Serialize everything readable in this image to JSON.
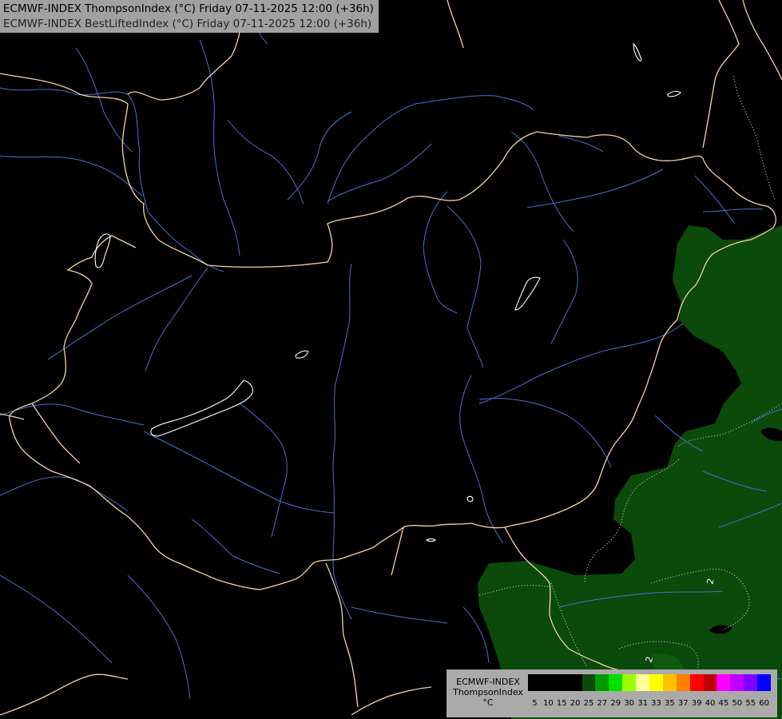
{
  "header": {
    "line1": "ECMWF-INDEX ThompsonIndex (°C) Friday 07-11-2025 12:00 (+36h)",
    "line2": "ECMWF-INDEX BestLiftedIndex (°C) Friday 07-11-2025 12:00 (+36h)"
  },
  "legend": {
    "name_line1": "ECMWF-INDEX",
    "name_line2": "ThompsonIndex",
    "unit": "°C",
    "bins": [
      {
        "label": "5",
        "color": "#000000"
      },
      {
        "label": "10",
        "color": "#000000"
      },
      {
        "label": "15",
        "color": "#000000"
      },
      {
        "label": "20",
        "color": "#000000"
      },
      {
        "label": "25",
        "color": "#0b4a0b"
      },
      {
        "label": "27",
        "color": "#009a00"
      },
      {
        "label": "29",
        "color": "#00e100"
      },
      {
        "label": "30",
        "color": "#99ff00"
      },
      {
        "label": "31",
        "color": "#ffff99"
      },
      {
        "label": "33",
        "color": "#ffff00"
      },
      {
        "label": "35",
        "color": "#ffc000"
      },
      {
        "label": "37",
        "color": "#ff7f00"
      },
      {
        "label": "39",
        "color": "#ff0000"
      },
      {
        "label": "40",
        "color": "#c00000"
      },
      {
        "label": "45",
        "color": "#ff00ff"
      },
      {
        "label": "50",
        "color": "#c000ff"
      },
      {
        "label": "55",
        "color": "#7f00ff"
      },
      {
        "label": "60",
        "color": "#0000ff"
      }
    ]
  },
  "map": {
    "colors": {
      "background": "#000000",
      "border": "#f5d4a6",
      "river": "#4c6fd0",
      "lake": "#ffffff",
      "shade": "#0b4a0b",
      "shade_light": "#0e5a0e",
      "isoline": "#d0d0d0"
    },
    "contour_labels": [
      "2",
      "2"
    ]
  }
}
